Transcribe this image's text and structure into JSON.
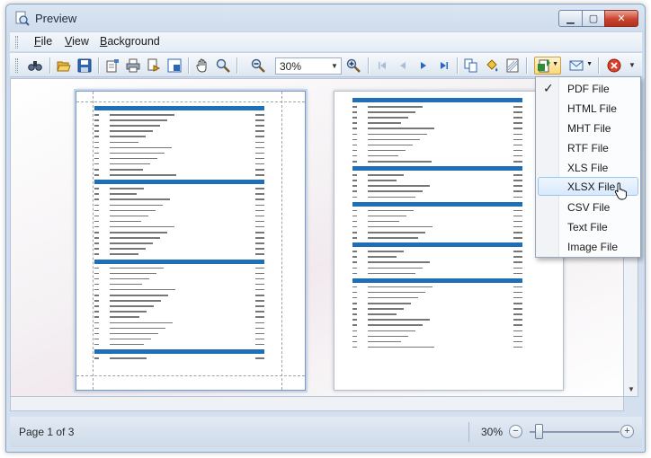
{
  "window": {
    "title": "Preview",
    "minimize_icon": "minimize-icon",
    "maximize_icon": "maximize-icon",
    "close_icon": "close-icon"
  },
  "menu": [
    "File",
    "View",
    "Background"
  ],
  "toolbar": {
    "zoom_value": "30%",
    "icons": [
      "find-icon",
      "open-icon",
      "save-icon",
      "print-setup-icon",
      "print-icon",
      "quick-print-icon",
      "page-setup-icon",
      "hand-tool-icon",
      "magnifier-icon",
      "zoom-out-icon",
      "zoom-in-icon",
      "first-page-icon",
      "previous-page-icon",
      "next-page-icon",
      "last-page-icon",
      "multiple-pages-icon",
      "fill-background-icon",
      "watermark-icon",
      "export-icon",
      "send-email-icon",
      "close-preview-icon"
    ]
  },
  "export_menu": {
    "items": [
      {
        "label": "PDF File",
        "checked": true
      },
      {
        "label": "HTML File"
      },
      {
        "label": "MHT File"
      },
      {
        "label": "RTF File"
      },
      {
        "label": "XLS File"
      },
      {
        "label": "XLSX File",
        "hovered": true
      },
      {
        "label": "CSV File"
      },
      {
        "label": "Text File"
      },
      {
        "label": "Image File"
      }
    ]
  },
  "status": {
    "page": "Page 1 of 3",
    "zoom": "30%",
    "zoom_out_label": "−",
    "zoom_in_label": "+"
  },
  "colors": {
    "accent": "#1f6fb6",
    "window_frame": "#cfdcec",
    "hover": "#d7e9fc"
  }
}
